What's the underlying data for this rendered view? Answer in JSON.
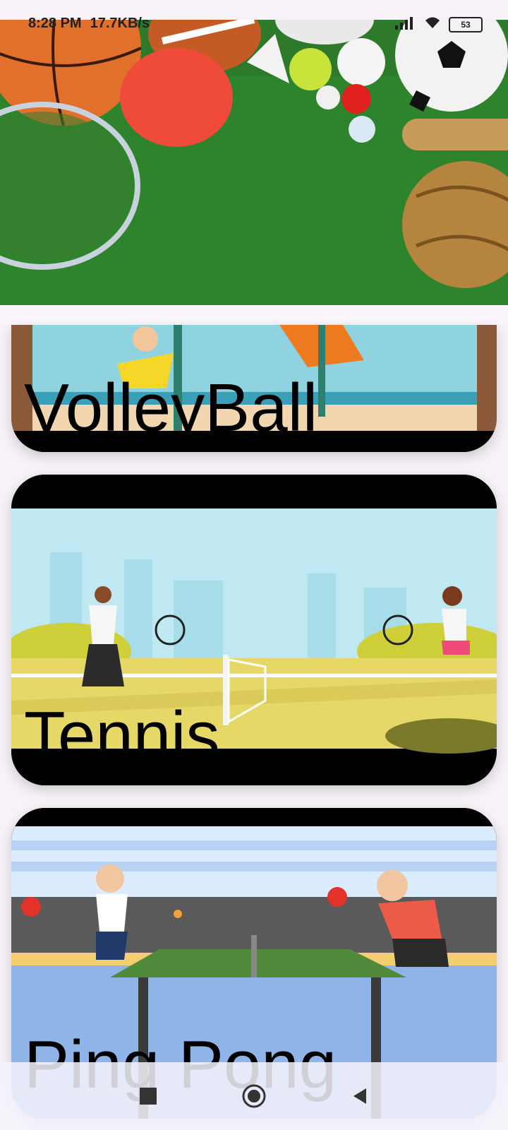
{
  "status_bar": {
    "time": "8:28 PM",
    "net_speed": "17.7KB/s",
    "battery": "53"
  },
  "sports": [
    {
      "name": "VolleyBall"
    },
    {
      "name": "Tennis"
    },
    {
      "name": "Ping Pong"
    }
  ],
  "icons": {
    "wifi": "wifi-icon",
    "signal": "signal-icon",
    "battery": "battery-icon",
    "recents": "square-recents-icon",
    "home": "circle-home-icon",
    "back": "triangle-back-icon"
  }
}
